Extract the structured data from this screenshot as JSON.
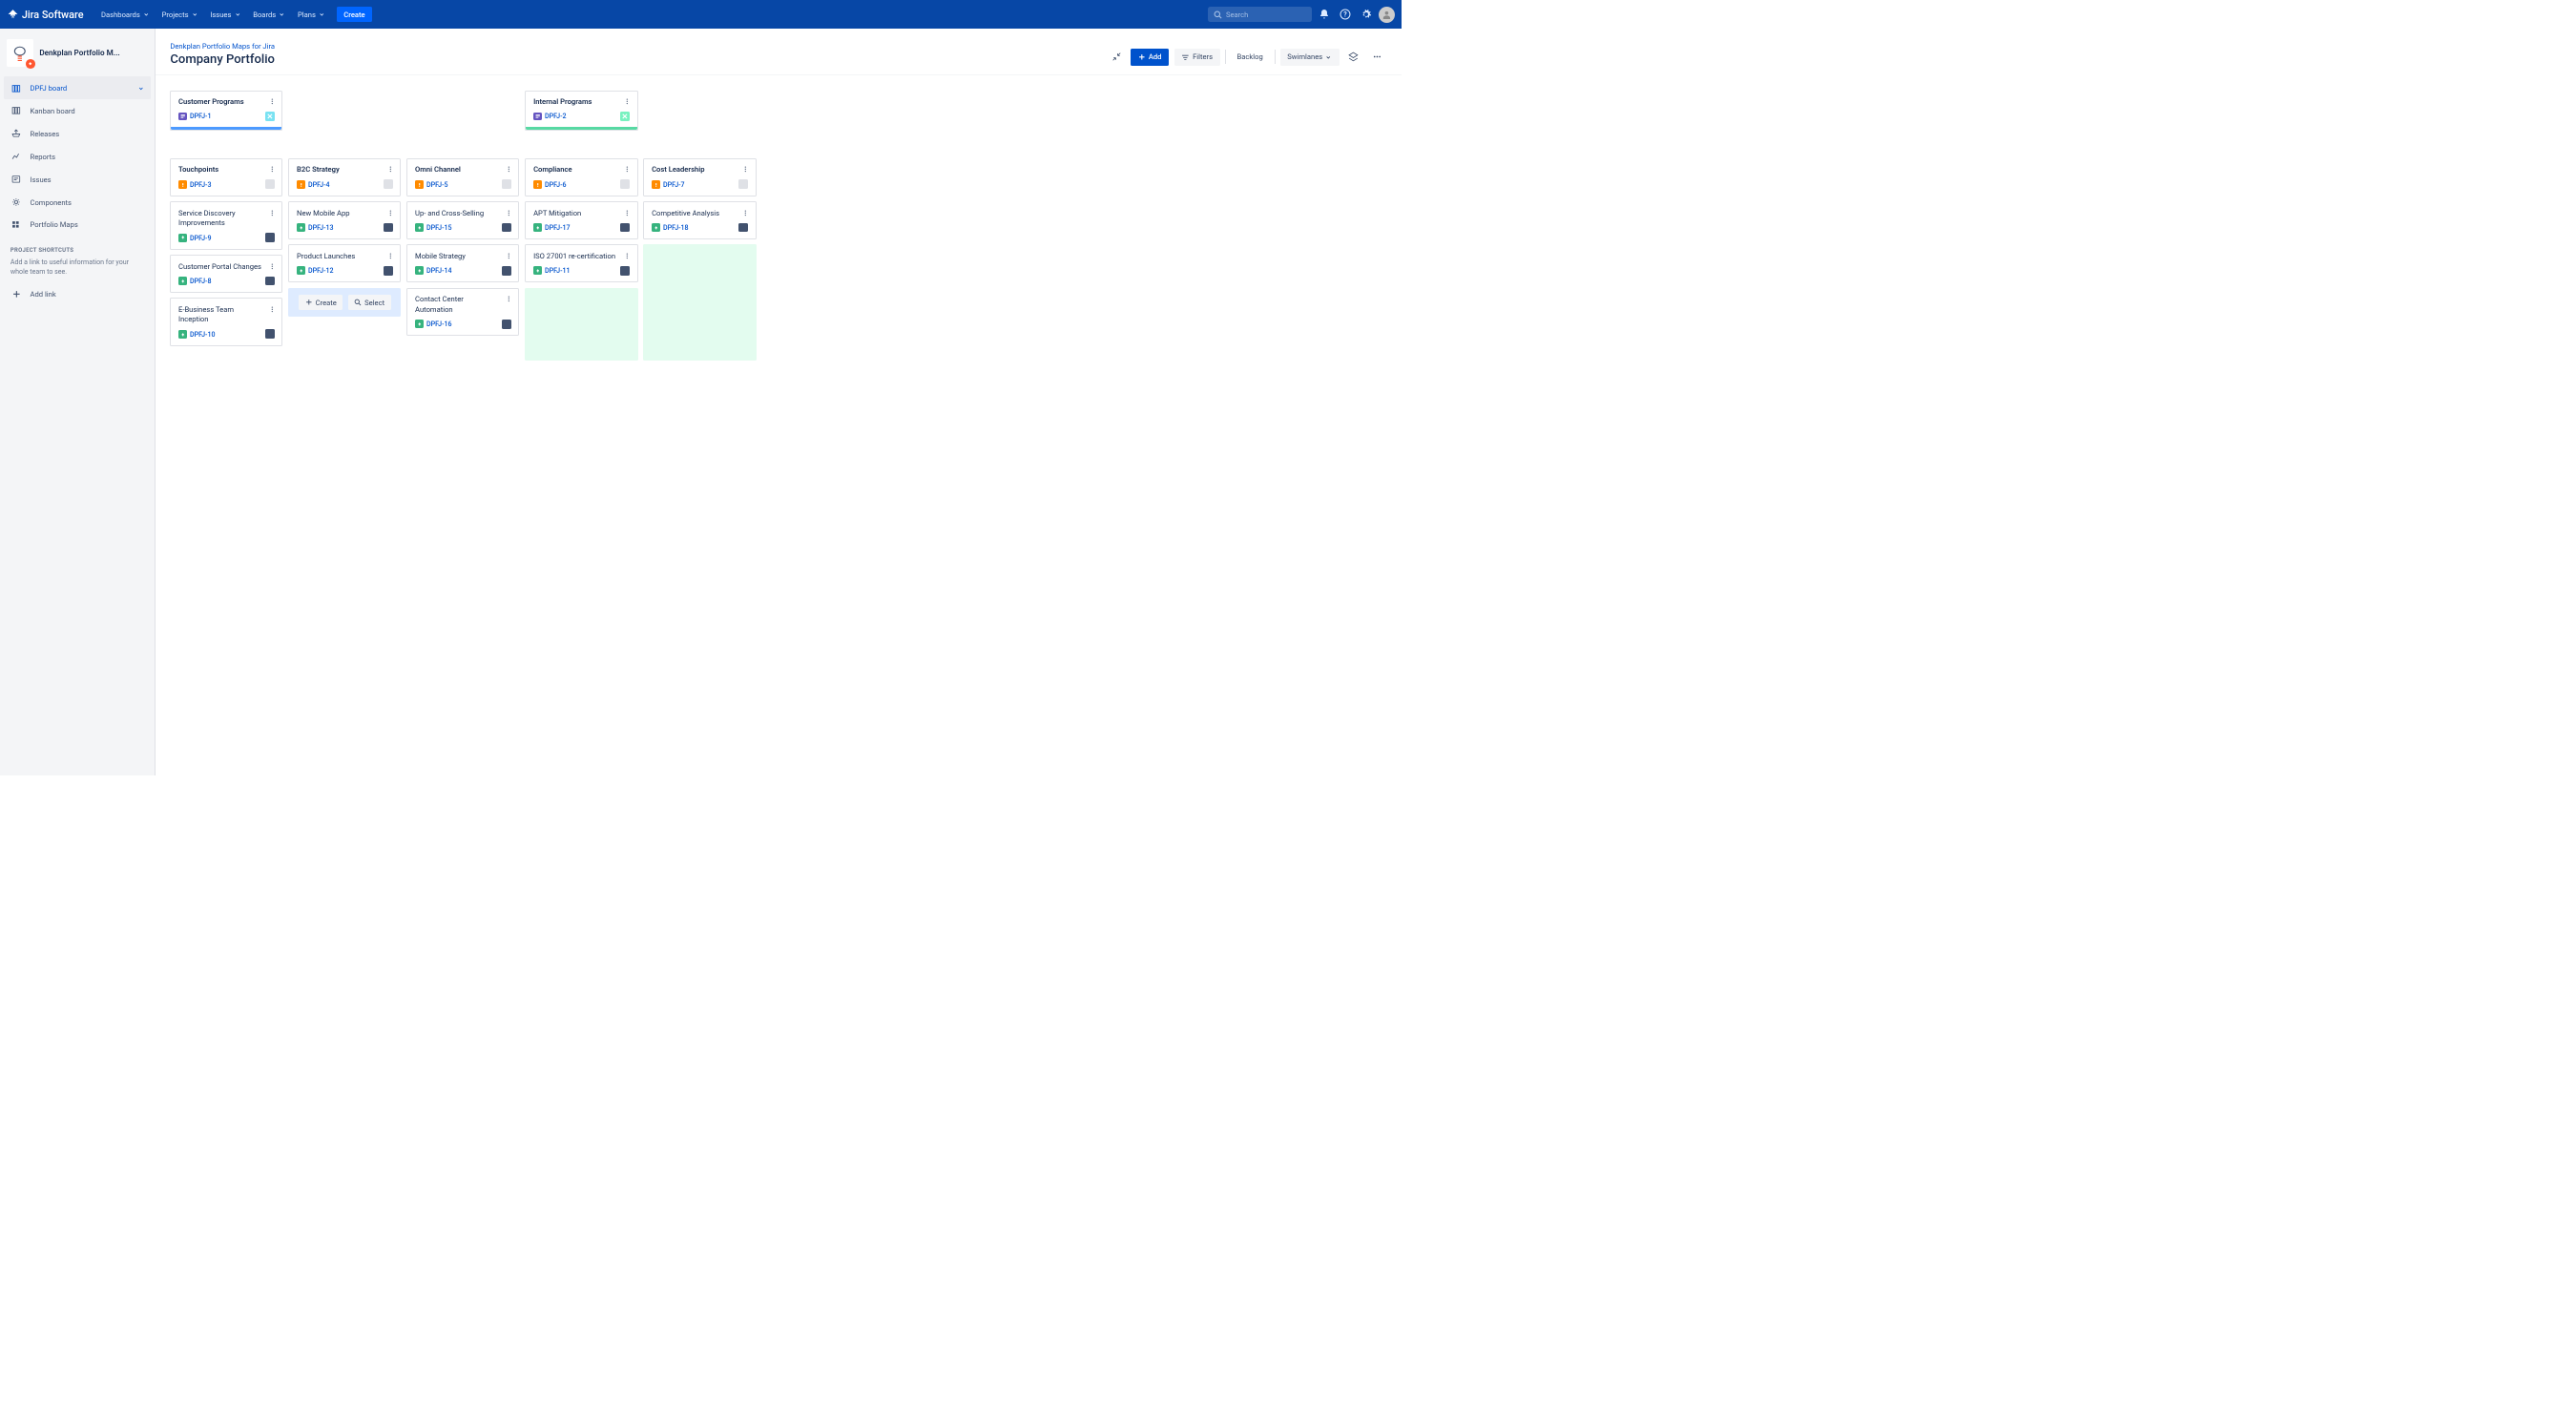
{
  "topbar": {
    "logo_text": "Jira Software",
    "nav": [
      "Dashboards",
      "Projects",
      "Issues",
      "Boards",
      "Plans"
    ],
    "create": "Create",
    "search_placeholder": "Search"
  },
  "sidebar": {
    "project_title": "Denkplan Portfolio M...",
    "items": [
      {
        "label": "DPFJ board",
        "active": true,
        "icon": "board",
        "chevron": true
      },
      {
        "label": "Kanban board",
        "icon": "board"
      },
      {
        "label": "Releases",
        "icon": "ship"
      },
      {
        "label": "Reports",
        "icon": "chart"
      },
      {
        "label": "Issues",
        "icon": "issue"
      },
      {
        "label": "Components",
        "icon": "gear"
      },
      {
        "label": "Portfolio Maps",
        "icon": "grid"
      }
    ],
    "shortcuts_header": "PROJECT SHORTCUTS",
    "shortcuts_text": "Add a link to useful information for your whole team to see.",
    "add_link": "Add link"
  },
  "header": {
    "breadcrumb": "Denkplan Portfolio Maps for Jira",
    "title": "Company Portfolio",
    "add": "Add",
    "filters": "Filters",
    "backlog": "Backlog",
    "swimlanes": "Swimlanes"
  },
  "board": {
    "programs": [
      {
        "title": "Customer Programs",
        "key": "DPFJ-1",
        "type": "story",
        "status": "blue",
        "bar": "blue",
        "col": 0
      },
      {
        "title": "Internal Programs",
        "key": "DPFJ-2",
        "type": "story",
        "status": "green",
        "bar": "green",
        "col": 3
      }
    ],
    "epics": [
      {
        "title": "Touchpoints",
        "key": "DPFJ-3",
        "type": "high",
        "status": "grey"
      },
      {
        "title": "B2C Strategy",
        "key": "DPFJ-4",
        "type": "high",
        "status": "grey"
      },
      {
        "title": "Omni Channel",
        "key": "DPFJ-5",
        "type": "high",
        "status": "grey"
      },
      {
        "title": "Compliance",
        "key": "DPFJ-6",
        "type": "high",
        "status": "grey"
      },
      {
        "title": "Cost Leadership",
        "key": "DPFJ-7",
        "type": "high",
        "status": "grey"
      }
    ],
    "columns": [
      {
        "items": [
          {
            "title": "Service Discovery Improvements",
            "key": "DPFJ-9",
            "type": "up",
            "status": "dark"
          },
          {
            "title": "Customer Portal Changes",
            "key": "DPFJ-8",
            "type": "up",
            "status": "dark"
          },
          {
            "title": "E-Business Team Inception",
            "key": "DPFJ-10",
            "type": "up",
            "status": "dark"
          }
        ]
      },
      {
        "items": [
          {
            "title": "New Mobile App",
            "key": "DPFJ-13",
            "type": "up",
            "status": "dark"
          },
          {
            "title": "Product Launches",
            "key": "DPFJ-12",
            "type": "up",
            "status": "dark"
          }
        ],
        "select_zone": true
      },
      {
        "items": [
          {
            "title": "Up- and Cross-Selling",
            "key": "DPFJ-15",
            "type": "up",
            "status": "dark"
          },
          {
            "title": "Mobile Strategy",
            "key": "DPFJ-14",
            "type": "up",
            "status": "dark"
          },
          {
            "title": "Contact Center Automation",
            "key": "DPFJ-16",
            "type": "up",
            "status": "dark"
          }
        ]
      },
      {
        "items": [
          {
            "title": "APT Mitigation",
            "key": "DPFJ-17",
            "type": "up",
            "status": "dark"
          },
          {
            "title": "ISO 27001 re-certification",
            "key": "DPFJ-11",
            "type": "up",
            "status": "dark"
          }
        ],
        "drop_zone": true
      },
      {
        "items": [
          {
            "title": "Competitive Analysis",
            "key": "DPFJ-18",
            "type": "up",
            "status": "dark"
          }
        ],
        "drop_zone": true
      }
    ],
    "create_btn": "Create",
    "select_btn": "Select"
  }
}
